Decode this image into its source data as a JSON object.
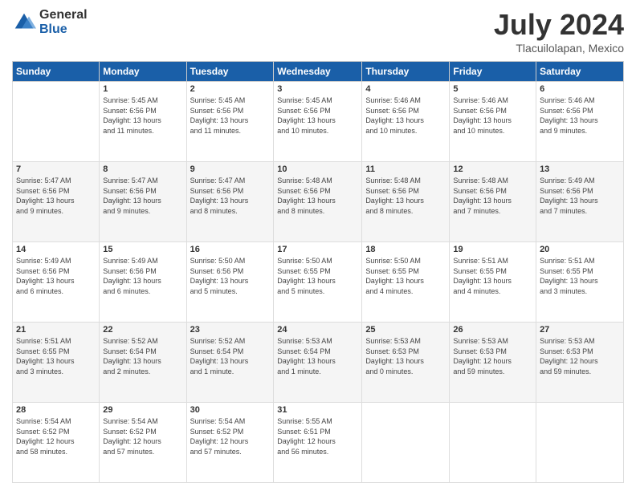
{
  "logo": {
    "general": "General",
    "blue": "Blue"
  },
  "header": {
    "title": "July 2024",
    "subtitle": "Tlacuilolapan, Mexico"
  },
  "columns": [
    "Sunday",
    "Monday",
    "Tuesday",
    "Wednesday",
    "Thursday",
    "Friday",
    "Saturday"
  ],
  "weeks": [
    [
      {
        "day": "",
        "info": ""
      },
      {
        "day": "1",
        "info": "Sunrise: 5:45 AM\nSunset: 6:56 PM\nDaylight: 13 hours\nand 11 minutes."
      },
      {
        "day": "2",
        "info": "Sunrise: 5:45 AM\nSunset: 6:56 PM\nDaylight: 13 hours\nand 11 minutes."
      },
      {
        "day": "3",
        "info": "Sunrise: 5:45 AM\nSunset: 6:56 PM\nDaylight: 13 hours\nand 10 minutes."
      },
      {
        "day": "4",
        "info": "Sunrise: 5:46 AM\nSunset: 6:56 PM\nDaylight: 13 hours\nand 10 minutes."
      },
      {
        "day": "5",
        "info": "Sunrise: 5:46 AM\nSunset: 6:56 PM\nDaylight: 13 hours\nand 10 minutes."
      },
      {
        "day": "6",
        "info": "Sunrise: 5:46 AM\nSunset: 6:56 PM\nDaylight: 13 hours\nand 9 minutes."
      }
    ],
    [
      {
        "day": "7",
        "info": "Sunrise: 5:47 AM\nSunset: 6:56 PM\nDaylight: 13 hours\nand 9 minutes."
      },
      {
        "day": "8",
        "info": "Sunrise: 5:47 AM\nSunset: 6:56 PM\nDaylight: 13 hours\nand 9 minutes."
      },
      {
        "day": "9",
        "info": "Sunrise: 5:47 AM\nSunset: 6:56 PM\nDaylight: 13 hours\nand 8 minutes."
      },
      {
        "day": "10",
        "info": "Sunrise: 5:48 AM\nSunset: 6:56 PM\nDaylight: 13 hours\nand 8 minutes."
      },
      {
        "day": "11",
        "info": "Sunrise: 5:48 AM\nSunset: 6:56 PM\nDaylight: 13 hours\nand 8 minutes."
      },
      {
        "day": "12",
        "info": "Sunrise: 5:48 AM\nSunset: 6:56 PM\nDaylight: 13 hours\nand 7 minutes."
      },
      {
        "day": "13",
        "info": "Sunrise: 5:49 AM\nSunset: 6:56 PM\nDaylight: 13 hours\nand 7 minutes."
      }
    ],
    [
      {
        "day": "14",
        "info": "Sunrise: 5:49 AM\nSunset: 6:56 PM\nDaylight: 13 hours\nand 6 minutes."
      },
      {
        "day": "15",
        "info": "Sunrise: 5:49 AM\nSunset: 6:56 PM\nDaylight: 13 hours\nand 6 minutes."
      },
      {
        "day": "16",
        "info": "Sunrise: 5:50 AM\nSunset: 6:56 PM\nDaylight: 13 hours\nand 5 minutes."
      },
      {
        "day": "17",
        "info": "Sunrise: 5:50 AM\nSunset: 6:55 PM\nDaylight: 13 hours\nand 5 minutes."
      },
      {
        "day": "18",
        "info": "Sunrise: 5:50 AM\nSunset: 6:55 PM\nDaylight: 13 hours\nand 4 minutes."
      },
      {
        "day": "19",
        "info": "Sunrise: 5:51 AM\nSunset: 6:55 PM\nDaylight: 13 hours\nand 4 minutes."
      },
      {
        "day": "20",
        "info": "Sunrise: 5:51 AM\nSunset: 6:55 PM\nDaylight: 13 hours\nand 3 minutes."
      }
    ],
    [
      {
        "day": "21",
        "info": "Sunrise: 5:51 AM\nSunset: 6:55 PM\nDaylight: 13 hours\nand 3 minutes."
      },
      {
        "day": "22",
        "info": "Sunrise: 5:52 AM\nSunset: 6:54 PM\nDaylight: 13 hours\nand 2 minutes."
      },
      {
        "day": "23",
        "info": "Sunrise: 5:52 AM\nSunset: 6:54 PM\nDaylight: 13 hours\nand 1 minute."
      },
      {
        "day": "24",
        "info": "Sunrise: 5:53 AM\nSunset: 6:54 PM\nDaylight: 13 hours\nand 1 minute."
      },
      {
        "day": "25",
        "info": "Sunrise: 5:53 AM\nSunset: 6:53 PM\nDaylight: 13 hours\nand 0 minutes."
      },
      {
        "day": "26",
        "info": "Sunrise: 5:53 AM\nSunset: 6:53 PM\nDaylight: 12 hours\nand 59 minutes."
      },
      {
        "day": "27",
        "info": "Sunrise: 5:53 AM\nSunset: 6:53 PM\nDaylight: 12 hours\nand 59 minutes."
      }
    ],
    [
      {
        "day": "28",
        "info": "Sunrise: 5:54 AM\nSunset: 6:52 PM\nDaylight: 12 hours\nand 58 minutes."
      },
      {
        "day": "29",
        "info": "Sunrise: 5:54 AM\nSunset: 6:52 PM\nDaylight: 12 hours\nand 57 minutes."
      },
      {
        "day": "30",
        "info": "Sunrise: 5:54 AM\nSunset: 6:52 PM\nDaylight: 12 hours\nand 57 minutes."
      },
      {
        "day": "31",
        "info": "Sunrise: 5:55 AM\nSunset: 6:51 PM\nDaylight: 12 hours\nand 56 minutes."
      },
      {
        "day": "",
        "info": ""
      },
      {
        "day": "",
        "info": ""
      },
      {
        "day": "",
        "info": ""
      }
    ]
  ]
}
